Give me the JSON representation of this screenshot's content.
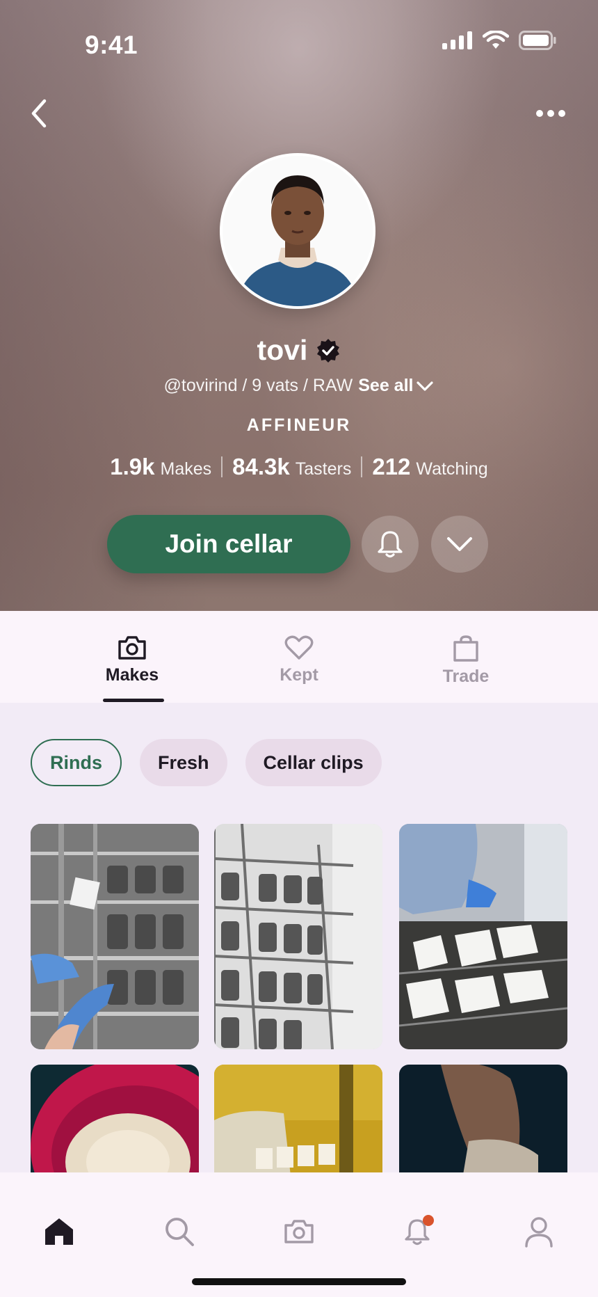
{
  "status_bar": {
    "time": "9:41"
  },
  "profile": {
    "name": "tovi",
    "handle": "@tovirind / 9 vats / RAW",
    "see_all": "See all",
    "role": "AFFINEUR",
    "stats": [
      {
        "value": "1.9k",
        "label": "Makes"
      },
      {
        "value": "84.3k",
        "label": "Tasters"
      },
      {
        "value": "212",
        "label": "Watching"
      }
    ],
    "join_label": "Join cellar"
  },
  "tabs": [
    {
      "label": "Makes",
      "icon": "camera-icon",
      "active": true
    },
    {
      "label": "Kept",
      "icon": "heart-icon",
      "active": false
    },
    {
      "label": "Trade",
      "icon": "bag-icon",
      "active": false
    }
  ],
  "chips": [
    {
      "label": "Rinds",
      "active": true
    },
    {
      "label": "Fresh",
      "active": false
    },
    {
      "label": "Cellar clips",
      "active": false
    }
  ],
  "bottom_nav": [
    {
      "icon": "home-icon",
      "active": true
    },
    {
      "icon": "search-icon",
      "active": false
    },
    {
      "icon": "camera-icon",
      "active": false
    },
    {
      "icon": "bell-icon",
      "active": false,
      "badge": true
    },
    {
      "icon": "profile-icon",
      "active": false
    }
  ],
  "colors": {
    "accent": "#2f6e52",
    "badge": "#d9532c",
    "background": "#f2ebf6"
  }
}
